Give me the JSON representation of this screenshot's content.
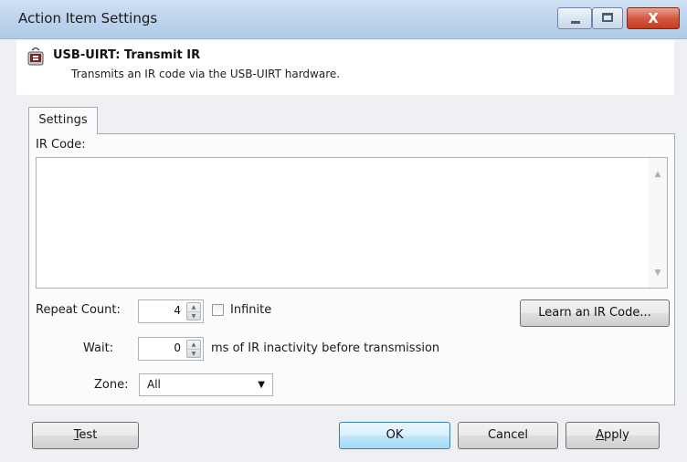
{
  "window": {
    "title": "Action Item Settings",
    "buttons": {
      "minimize": "–",
      "maximize": "□",
      "close": "X"
    }
  },
  "header": {
    "icon": "usb-icon",
    "title": "USB-UIRT: Transmit IR",
    "description": "Transmits an IR code via the USB-UIRT hardware."
  },
  "tabs": [
    {
      "label": "Settings"
    }
  ],
  "settings": {
    "ir_code_label": "IR Code:",
    "ir_code_value": "",
    "repeat_count_label": "Repeat Count:",
    "repeat_count_value": "4",
    "infinite_label": "Infinite",
    "infinite_checked": false,
    "learn_button": "Learn an IR Code...",
    "wait_label": "Wait:",
    "wait_value": "0",
    "wait_suffix": "ms of IR inactivity before transmission",
    "zone_label": "Zone:",
    "zone_value": "All"
  },
  "footer": {
    "test": {
      "mnemonic": "T",
      "rest": "est"
    },
    "ok": "OK",
    "cancel": "Cancel",
    "apply": {
      "mnemonic": "A",
      "rest": "pply"
    }
  }
}
